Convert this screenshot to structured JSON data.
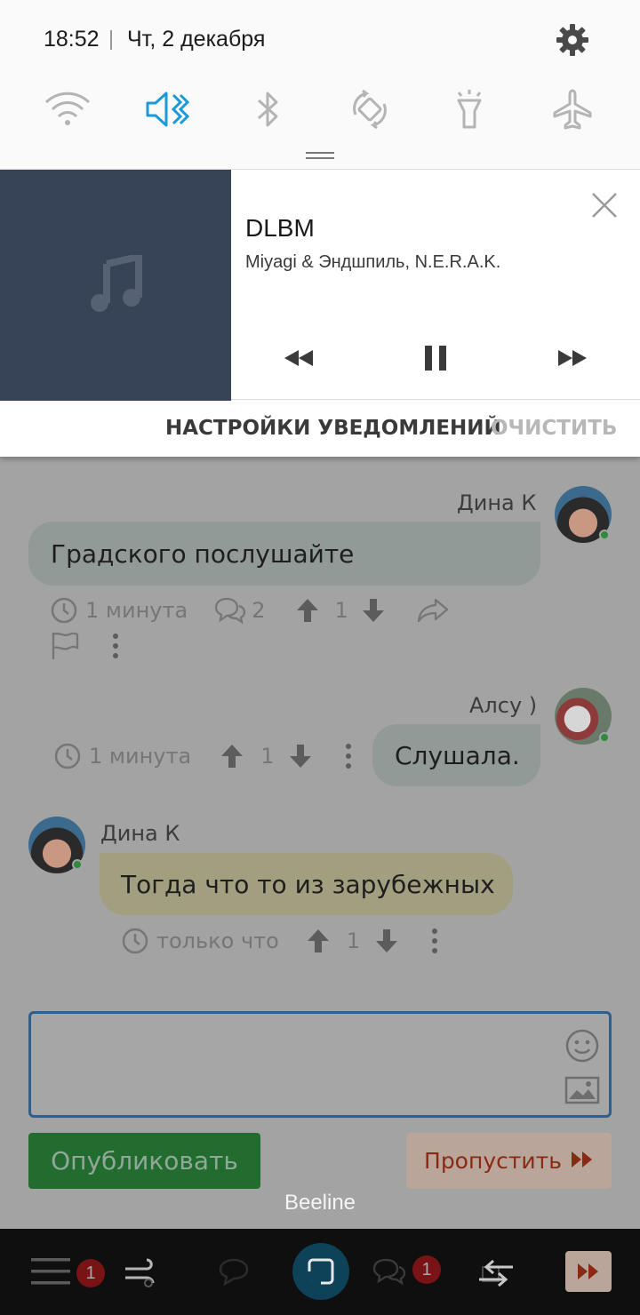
{
  "status": {
    "time": "18:52",
    "date": "Чт, 2 декабря"
  },
  "quick_settings": [
    {
      "icon": "wifi-icon",
      "active": false
    },
    {
      "icon": "mute-icon",
      "active": true
    },
    {
      "icon": "bluetooth-icon",
      "active": false
    },
    {
      "icon": "auto-rotate-icon",
      "active": false
    },
    {
      "icon": "flashlight-icon",
      "active": false
    },
    {
      "icon": "airplane-icon",
      "active": false
    }
  ],
  "media": {
    "title": "DLBM",
    "artist": "Miyagi & Эндшпиль, N.E.R.A.K."
  },
  "notification_actions": {
    "settings": "НАСТРОЙКИ УВЕДОМЛЕНИЙ",
    "clear": "ОЧИСТИТЬ"
  },
  "comments": [
    {
      "author": "Дина К",
      "text": "Градского послушайте",
      "time": "1 минута",
      "replies": "2",
      "votes": "1"
    },
    {
      "author": "Алсу )",
      "text": "Слушала.",
      "time": "1 минута",
      "votes": "1"
    },
    {
      "author": "Дина К",
      "text": "Тогда что то из зарубежных",
      "time": "только что",
      "votes": "1"
    }
  ],
  "composer": {
    "publish": "Опубликовать",
    "skip": "Пропустить"
  },
  "carrier": "Beeline",
  "bottom_nav": {
    "menu_badge": "1",
    "messages_badge": "1"
  },
  "colors": {
    "accent": "#1a9ad6",
    "art_bg": "#374457",
    "publish_bg": "#236c2f",
    "skip_bg": "#b9a59a"
  }
}
